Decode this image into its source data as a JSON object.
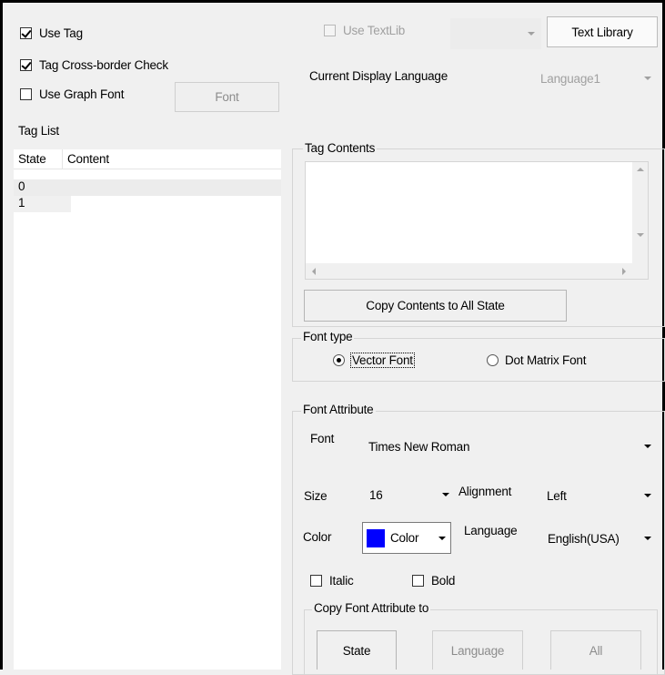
{
  "left_panel": {
    "use_tag": {
      "label": "Use Tag",
      "checked": true
    },
    "tag_cross_border": {
      "label": "Tag Cross-border Check",
      "checked": true
    },
    "use_graph_font": {
      "label": "Use Graph Font",
      "checked": false
    },
    "font_button": "Font",
    "tag_list": {
      "title": "Tag List",
      "columns": [
        "State",
        "Content"
      ],
      "rows": [
        {
          "state": "0",
          "content": ""
        },
        {
          "state": "1",
          "content": ""
        }
      ]
    }
  },
  "right_panel": {
    "use_textlib": {
      "label": "Use TextLib",
      "checked": false
    },
    "textlib_select": "",
    "text_library_button": "Text Library",
    "current_language_label": "Current Display Language",
    "current_language_value": "Language1",
    "tag_contents": {
      "title": "Tag Contents",
      "text": "",
      "copy_button": "Copy Contents to All State"
    },
    "font_type": {
      "title": "Font type",
      "options": [
        {
          "label": "Vector Font",
          "selected": true
        },
        {
          "label": "Dot Matrix Font",
          "selected": false
        }
      ]
    },
    "font_attribute": {
      "title": "Font Attribute",
      "font_label": "Font",
      "font_value": "Times New Roman",
      "size_label": "Size",
      "size_value": "16",
      "alignment_label": "Alignment",
      "alignment_value": "Left",
      "color_label": "Color",
      "color_button": "Color",
      "color_value": "#0000ff",
      "language_label": "Language",
      "language_value": "English(USA)",
      "italic": {
        "label": "Italic",
        "checked": false
      },
      "bold": {
        "label": "Bold",
        "checked": false
      },
      "copy_group": {
        "title": "Copy Font Attribute to",
        "buttons": [
          "State",
          "Language",
          "All"
        ]
      }
    }
  }
}
